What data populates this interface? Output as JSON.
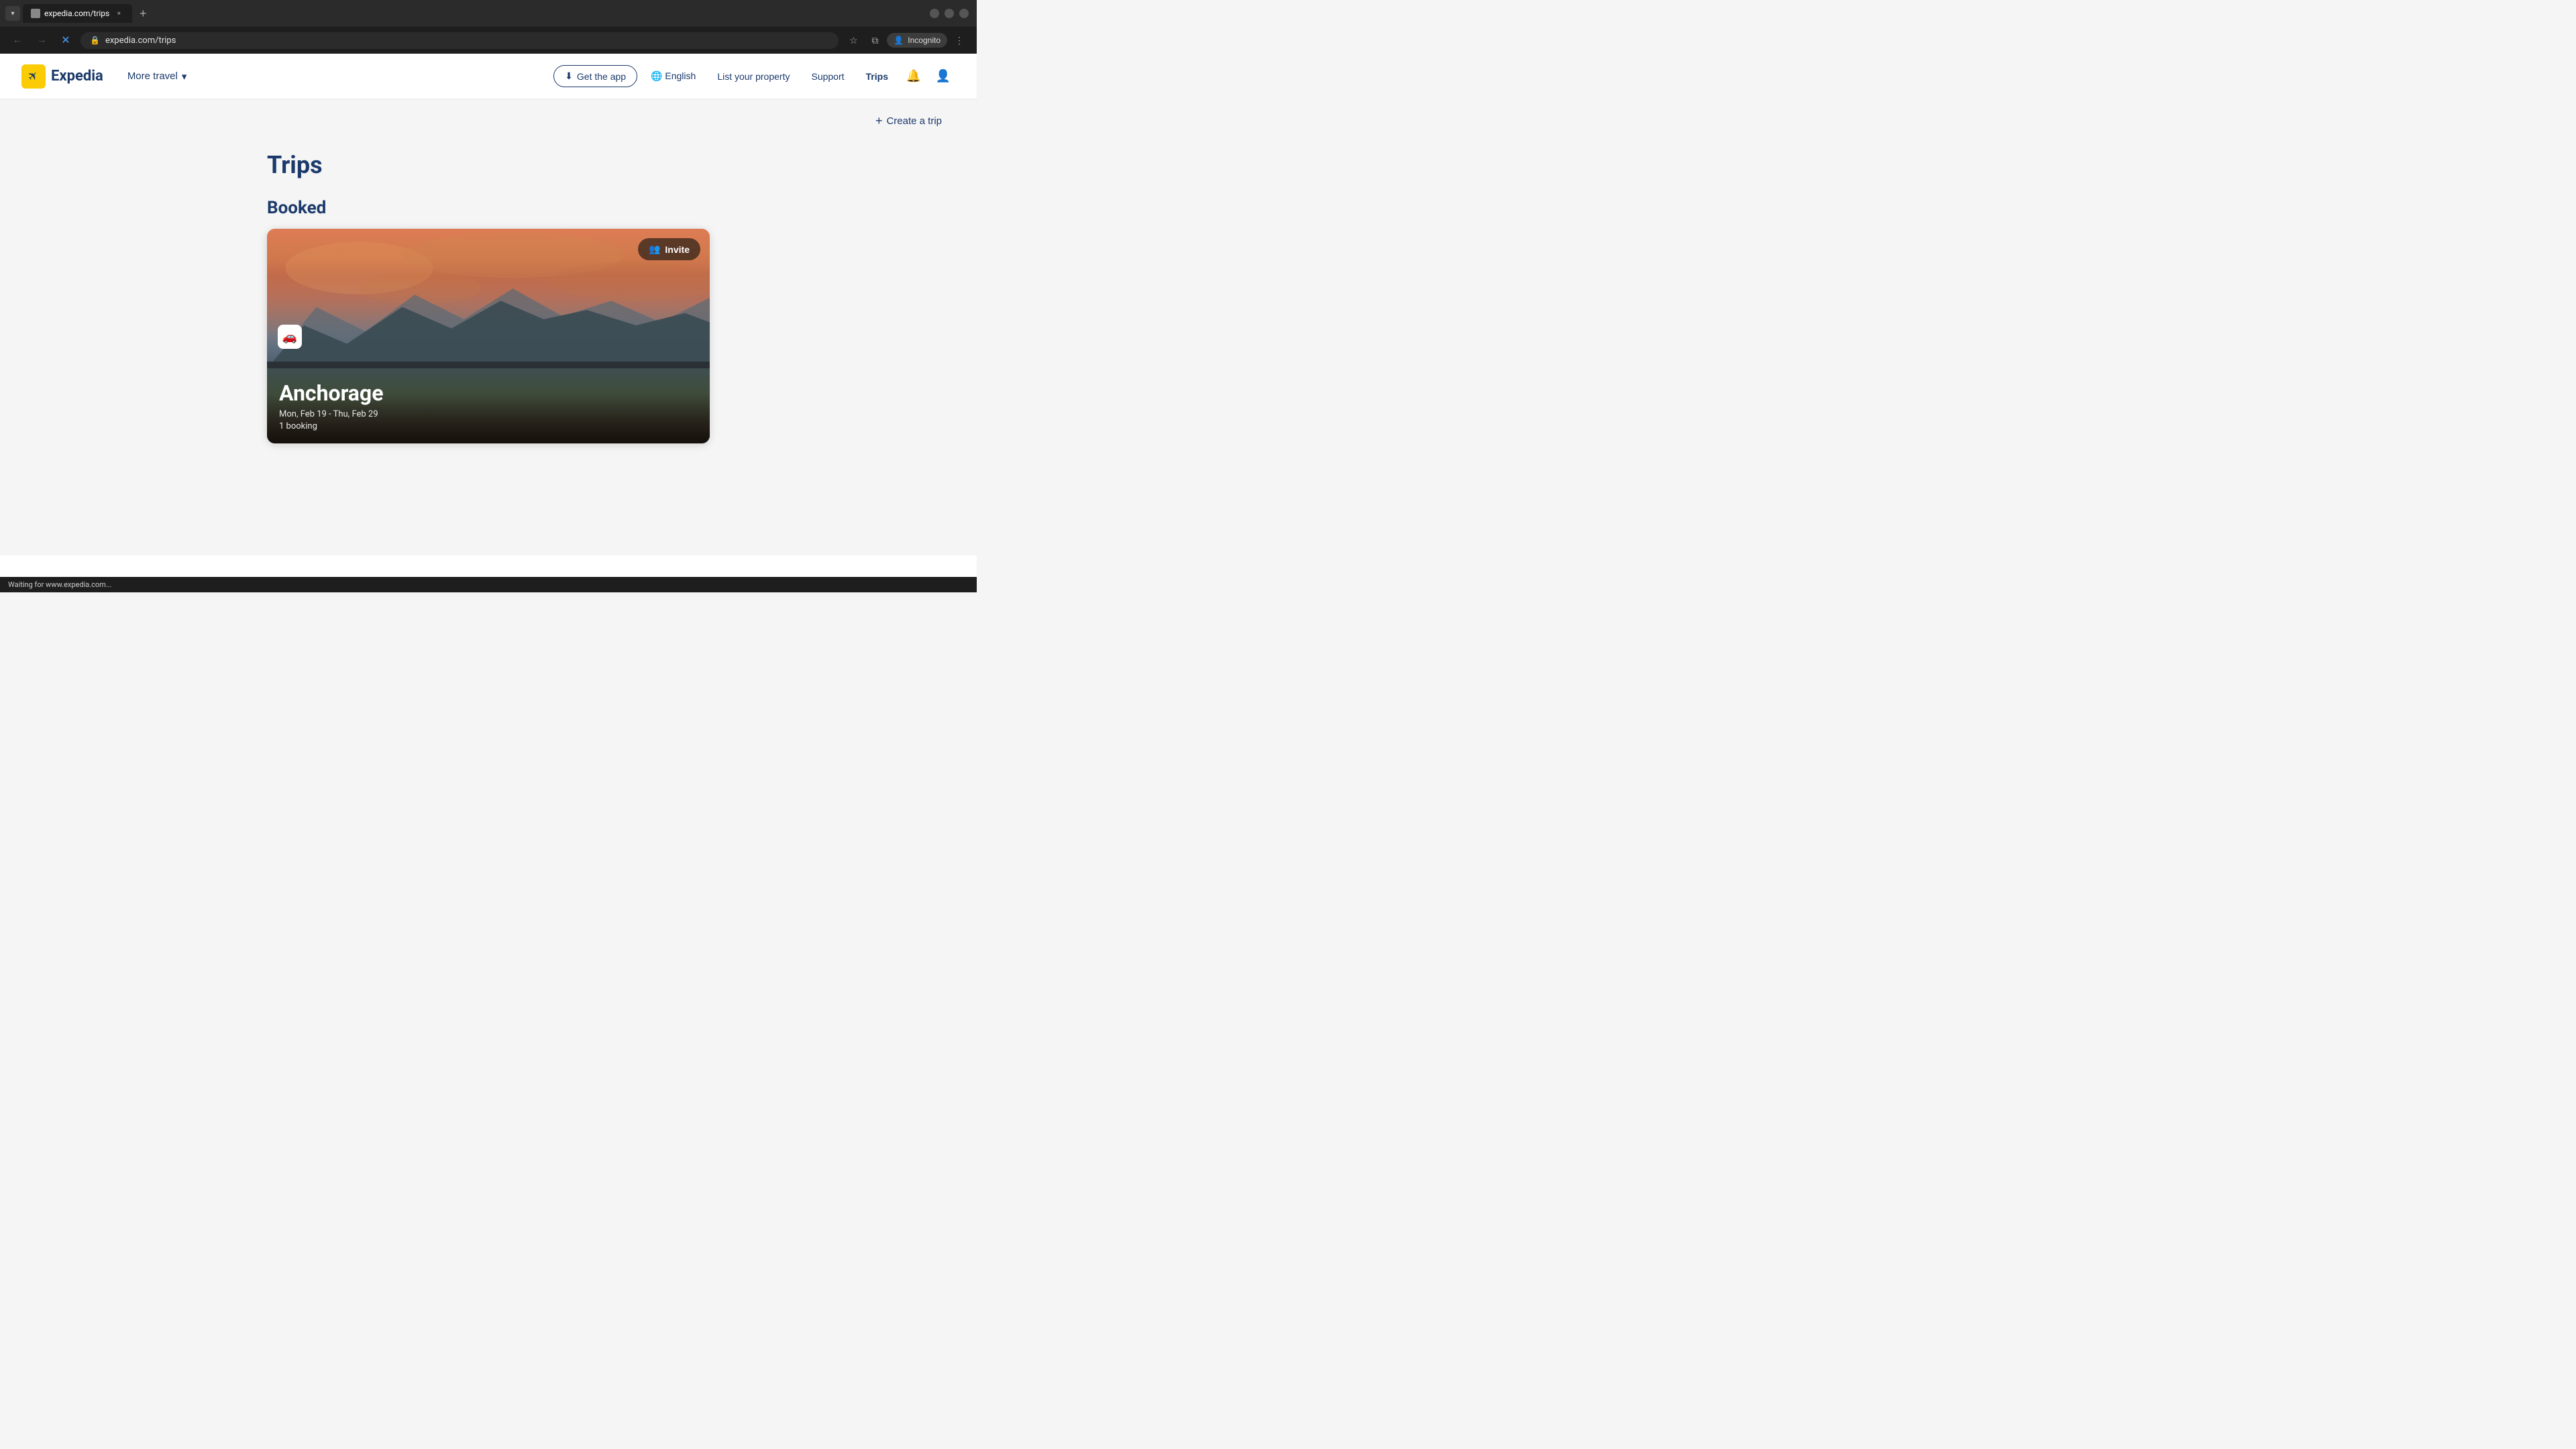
{
  "browser": {
    "tab": {
      "favicon": "🔗",
      "title": "expedia.com/trips",
      "close_label": "×"
    },
    "new_tab_label": "+",
    "address_bar": {
      "url": "expedia.com/trips",
      "lock_icon": "🔒"
    },
    "toolbar": {
      "back_label": "←",
      "forward_label": "→",
      "reload_label": "✕",
      "star_label": "☆",
      "sidebar_label": "⧉",
      "more_label": "⋮"
    },
    "incognito": {
      "icon": "👤",
      "label": "Incognito"
    },
    "tab_dropdown_icon": "▾"
  },
  "site": {
    "logo": {
      "text": "Expedia"
    },
    "nav": {
      "more_travel": "More travel",
      "dropdown_icon": "▾",
      "get_app": "Get the app",
      "get_app_icon": "⬇",
      "language": "English",
      "language_icon": "🌐",
      "list_property": "List your property",
      "support": "Support",
      "trips": "Trips",
      "notification_icon": "🔔",
      "account_icon": "👤"
    },
    "create_trip": {
      "icon": "+",
      "label": "Create a trip"
    },
    "page": {
      "title": "Trips",
      "booked_section": "Booked"
    },
    "trip_card": {
      "invite_icon": "👥",
      "invite_label": "Invite",
      "car_icon": "🚗",
      "destination": "Anchorage",
      "dates": "Mon, Feb 19 - Thu, Feb 29",
      "bookings": "1 booking"
    }
  },
  "status_bar": {
    "text": "Waiting for www.expedia.com..."
  }
}
